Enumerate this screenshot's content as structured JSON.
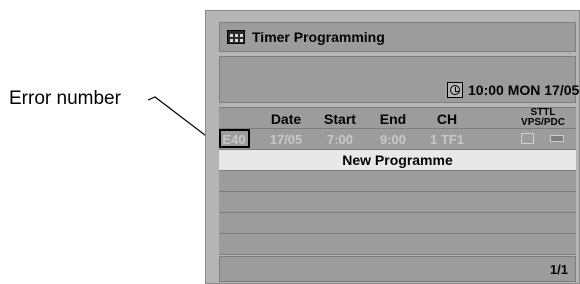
{
  "callout": {
    "label": "Error number"
  },
  "window": {
    "title": "Timer Programming",
    "icon": "menu-grid-icon",
    "clock_icon": "clock-icon",
    "datetime": "10:00 MON 17/05"
  },
  "table": {
    "headers": {
      "date": "Date",
      "start": "Start",
      "end": "End",
      "ch": "CH",
      "sttl": "STTL",
      "vps": "VPS/PDC"
    },
    "rows": [
      {
        "error": "E40",
        "date": "17/05",
        "start": "7:00",
        "end": "9:00",
        "ch": "1 TF1"
      }
    ],
    "new_programme": "New Programme"
  },
  "footer": {
    "page": "1/1"
  },
  "colors": {
    "panel": "#b5b5b5",
    "row": "#9c9c9c",
    "highlight": "#e8e8e8"
  }
}
